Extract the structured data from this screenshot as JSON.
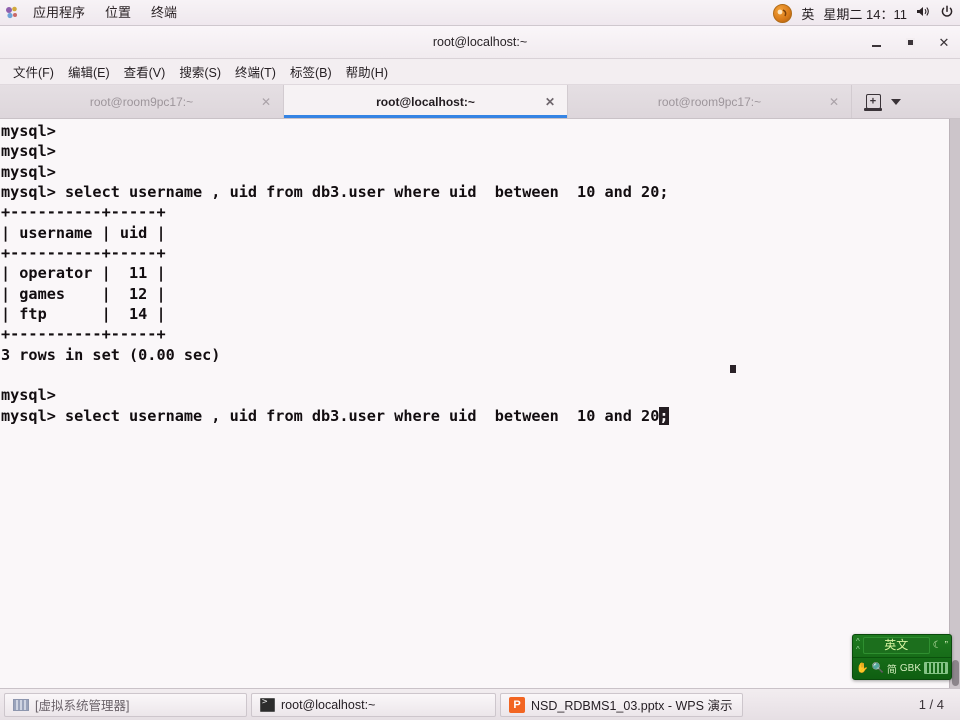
{
  "top_panel": {
    "apps_icon": "applications-icon",
    "menus": [
      "应用程序",
      "位置",
      "终端"
    ],
    "user_icon": "user-avatar-icon",
    "ime_indicator": "英",
    "clock": "星期二 14：11",
    "volume_icon": "volume-icon",
    "power_icon": "power-icon"
  },
  "window": {
    "title": "root@localhost:~",
    "minimize_label": "minimize",
    "maximize_label": "maximize",
    "close_label": "✕",
    "menubar": [
      "文件(F)",
      "编辑(E)",
      "查看(V)",
      "搜索(S)",
      "终端(T)",
      "标签(B)",
      "帮助(H)"
    ],
    "tabs": [
      {
        "title": "root@room9pc17:~",
        "active": false,
        "close": "✕"
      },
      {
        "title": "root@localhost:~",
        "active": true,
        "close": "✕"
      },
      {
        "title": "root@room9pc17:~",
        "active": false,
        "close": "✕"
      }
    ],
    "new_tab_icon": "new-tab-icon",
    "tab_list_icon": "chevron-down-icon"
  },
  "terminal": {
    "background": "#faf7f9",
    "foreground": "#120d10",
    "lines_before_cursor": "mysql>\nmysql>\nmysql>\nmysql> select username , uid from db3.user where uid  between  10 and 20;\n+----------+-----+\n| username | uid |\n+----------+-----+\n| operator |  11 |\n| games    |  12 |\n| ftp      |  14 |\n+----------+-----+\n3 rows in set (0.00 sec)\n\nmysql>\nmysql> select username , uid from db3.user where uid  between  10 and 20",
    "cursor_char": ";",
    "prompt": "mysql>",
    "query": "select username , uid from db3.user where uid  between  10 and 20;",
    "result_table": {
      "columns": [
        "username",
        "uid"
      ],
      "rows": [
        [
          "operator",
          "11"
        ],
        [
          "games",
          "12"
        ],
        [
          "ftp",
          "14"
        ]
      ],
      "status": "3 rows in set (0.00 sec)"
    }
  },
  "ime_panel": {
    "expand_icon": "chevrons-up-icon",
    "mode": "英文",
    "moon_icon": "moon-icon",
    "quote_icon": "quote-icon",
    "hand_icon": "hand-icon",
    "search_icon": "search-icon",
    "script": "简",
    "encoding": "GBK",
    "keyboard_icon": "keyboard-icon"
  },
  "taskbar": {
    "items": [
      {
        "label": "[虚拟系统管理器]",
        "icon": "virt-manager-icon",
        "active": false
      },
      {
        "label": "root@localhost:~",
        "icon": "terminal-icon",
        "active": true
      },
      {
        "label": "NSD_RDBMS1_03.pptx - WPS 演示",
        "icon": "wps-icon",
        "active": false
      }
    ],
    "workspace": "1 / 4"
  }
}
